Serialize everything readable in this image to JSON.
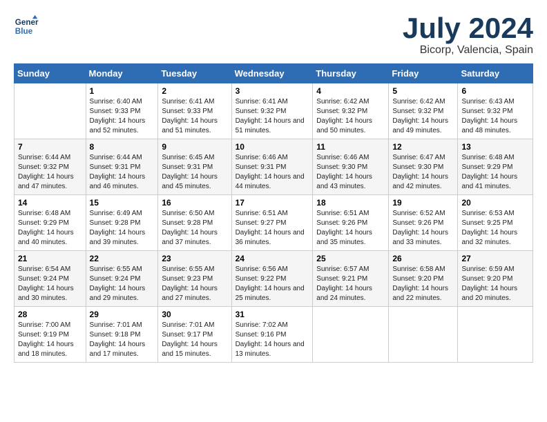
{
  "header": {
    "logo_line1": "General",
    "logo_line2": "Blue",
    "month": "July 2024",
    "location": "Bicorp, Valencia, Spain"
  },
  "weekdays": [
    "Sunday",
    "Monday",
    "Tuesday",
    "Wednesday",
    "Thursday",
    "Friday",
    "Saturday"
  ],
  "weeks": [
    [
      {
        "day": "",
        "sunrise": "",
        "sunset": "",
        "daylight": ""
      },
      {
        "day": "1",
        "sunrise": "Sunrise: 6:40 AM",
        "sunset": "Sunset: 9:33 PM",
        "daylight": "Daylight: 14 hours and 52 minutes."
      },
      {
        "day": "2",
        "sunrise": "Sunrise: 6:41 AM",
        "sunset": "Sunset: 9:33 PM",
        "daylight": "Daylight: 14 hours and 51 minutes."
      },
      {
        "day": "3",
        "sunrise": "Sunrise: 6:41 AM",
        "sunset": "Sunset: 9:32 PM",
        "daylight": "Daylight: 14 hours and 51 minutes."
      },
      {
        "day": "4",
        "sunrise": "Sunrise: 6:42 AM",
        "sunset": "Sunset: 9:32 PM",
        "daylight": "Daylight: 14 hours and 50 minutes."
      },
      {
        "day": "5",
        "sunrise": "Sunrise: 6:42 AM",
        "sunset": "Sunset: 9:32 PM",
        "daylight": "Daylight: 14 hours and 49 minutes."
      },
      {
        "day": "6",
        "sunrise": "Sunrise: 6:43 AM",
        "sunset": "Sunset: 9:32 PM",
        "daylight": "Daylight: 14 hours and 48 minutes."
      }
    ],
    [
      {
        "day": "7",
        "sunrise": "Sunrise: 6:44 AM",
        "sunset": "Sunset: 9:32 PM",
        "daylight": "Daylight: 14 hours and 47 minutes."
      },
      {
        "day": "8",
        "sunrise": "Sunrise: 6:44 AM",
        "sunset": "Sunset: 9:31 PM",
        "daylight": "Daylight: 14 hours and 46 minutes."
      },
      {
        "day": "9",
        "sunrise": "Sunrise: 6:45 AM",
        "sunset": "Sunset: 9:31 PM",
        "daylight": "Daylight: 14 hours and 45 minutes."
      },
      {
        "day": "10",
        "sunrise": "Sunrise: 6:46 AM",
        "sunset": "Sunset: 9:31 PM",
        "daylight": "Daylight: 14 hours and 44 minutes."
      },
      {
        "day": "11",
        "sunrise": "Sunrise: 6:46 AM",
        "sunset": "Sunset: 9:30 PM",
        "daylight": "Daylight: 14 hours and 43 minutes."
      },
      {
        "day": "12",
        "sunrise": "Sunrise: 6:47 AM",
        "sunset": "Sunset: 9:30 PM",
        "daylight": "Daylight: 14 hours and 42 minutes."
      },
      {
        "day": "13",
        "sunrise": "Sunrise: 6:48 AM",
        "sunset": "Sunset: 9:29 PM",
        "daylight": "Daylight: 14 hours and 41 minutes."
      }
    ],
    [
      {
        "day": "14",
        "sunrise": "Sunrise: 6:48 AM",
        "sunset": "Sunset: 9:29 PM",
        "daylight": "Daylight: 14 hours and 40 minutes."
      },
      {
        "day": "15",
        "sunrise": "Sunrise: 6:49 AM",
        "sunset": "Sunset: 9:28 PM",
        "daylight": "Daylight: 14 hours and 39 minutes."
      },
      {
        "day": "16",
        "sunrise": "Sunrise: 6:50 AM",
        "sunset": "Sunset: 9:28 PM",
        "daylight": "Daylight: 14 hours and 37 minutes."
      },
      {
        "day": "17",
        "sunrise": "Sunrise: 6:51 AM",
        "sunset": "Sunset: 9:27 PM",
        "daylight": "Daylight: 14 hours and 36 minutes."
      },
      {
        "day": "18",
        "sunrise": "Sunrise: 6:51 AM",
        "sunset": "Sunset: 9:26 PM",
        "daylight": "Daylight: 14 hours and 35 minutes."
      },
      {
        "day": "19",
        "sunrise": "Sunrise: 6:52 AM",
        "sunset": "Sunset: 9:26 PM",
        "daylight": "Daylight: 14 hours and 33 minutes."
      },
      {
        "day": "20",
        "sunrise": "Sunrise: 6:53 AM",
        "sunset": "Sunset: 9:25 PM",
        "daylight": "Daylight: 14 hours and 32 minutes."
      }
    ],
    [
      {
        "day": "21",
        "sunrise": "Sunrise: 6:54 AM",
        "sunset": "Sunset: 9:24 PM",
        "daylight": "Daylight: 14 hours and 30 minutes."
      },
      {
        "day": "22",
        "sunrise": "Sunrise: 6:55 AM",
        "sunset": "Sunset: 9:24 PM",
        "daylight": "Daylight: 14 hours and 29 minutes."
      },
      {
        "day": "23",
        "sunrise": "Sunrise: 6:55 AM",
        "sunset": "Sunset: 9:23 PM",
        "daylight": "Daylight: 14 hours and 27 minutes."
      },
      {
        "day": "24",
        "sunrise": "Sunrise: 6:56 AM",
        "sunset": "Sunset: 9:22 PM",
        "daylight": "Daylight: 14 hours and 25 minutes."
      },
      {
        "day": "25",
        "sunrise": "Sunrise: 6:57 AM",
        "sunset": "Sunset: 9:21 PM",
        "daylight": "Daylight: 14 hours and 24 minutes."
      },
      {
        "day": "26",
        "sunrise": "Sunrise: 6:58 AM",
        "sunset": "Sunset: 9:20 PM",
        "daylight": "Daylight: 14 hours and 22 minutes."
      },
      {
        "day": "27",
        "sunrise": "Sunrise: 6:59 AM",
        "sunset": "Sunset: 9:20 PM",
        "daylight": "Daylight: 14 hours and 20 minutes."
      }
    ],
    [
      {
        "day": "28",
        "sunrise": "Sunrise: 7:00 AM",
        "sunset": "Sunset: 9:19 PM",
        "daylight": "Daylight: 14 hours and 18 minutes."
      },
      {
        "day": "29",
        "sunrise": "Sunrise: 7:01 AM",
        "sunset": "Sunset: 9:18 PM",
        "daylight": "Daylight: 14 hours and 17 minutes."
      },
      {
        "day": "30",
        "sunrise": "Sunrise: 7:01 AM",
        "sunset": "Sunset: 9:17 PM",
        "daylight": "Daylight: 14 hours and 15 minutes."
      },
      {
        "day": "31",
        "sunrise": "Sunrise: 7:02 AM",
        "sunset": "Sunset: 9:16 PM",
        "daylight": "Daylight: 14 hours and 13 minutes."
      },
      {
        "day": "",
        "sunrise": "",
        "sunset": "",
        "daylight": ""
      },
      {
        "day": "",
        "sunrise": "",
        "sunset": "",
        "daylight": ""
      },
      {
        "day": "",
        "sunrise": "",
        "sunset": "",
        "daylight": ""
      }
    ]
  ]
}
